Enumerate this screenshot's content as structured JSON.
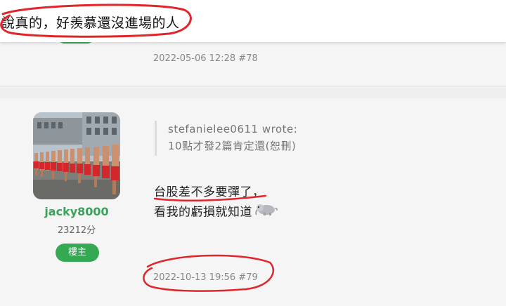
{
  "topic": {
    "title": "說真的，好羨慕還沒進場的人"
  },
  "previous_post": {
    "date": "2022-05-06 12:28",
    "floor": "#78"
  },
  "post": {
    "author": {
      "username": "jacky8000",
      "points": "23212分",
      "role_badge": "樓主"
    },
    "quote": {
      "author_line": "stefanielee0611 wrote:",
      "text": "10點才發2篇肯定還(恕刪)"
    },
    "body_lines": [
      "台股差不多要彈了，",
      "看我的虧損就知道"
    ],
    "emoji": "sad-elephant-icon",
    "date": "2022-10-13 19:56",
    "floor": "#79"
  },
  "colors": {
    "username": "#3aa35a",
    "badge_bg": "#34a853",
    "annotation_red": "#e0262b",
    "meta_text": "#888888"
  }
}
